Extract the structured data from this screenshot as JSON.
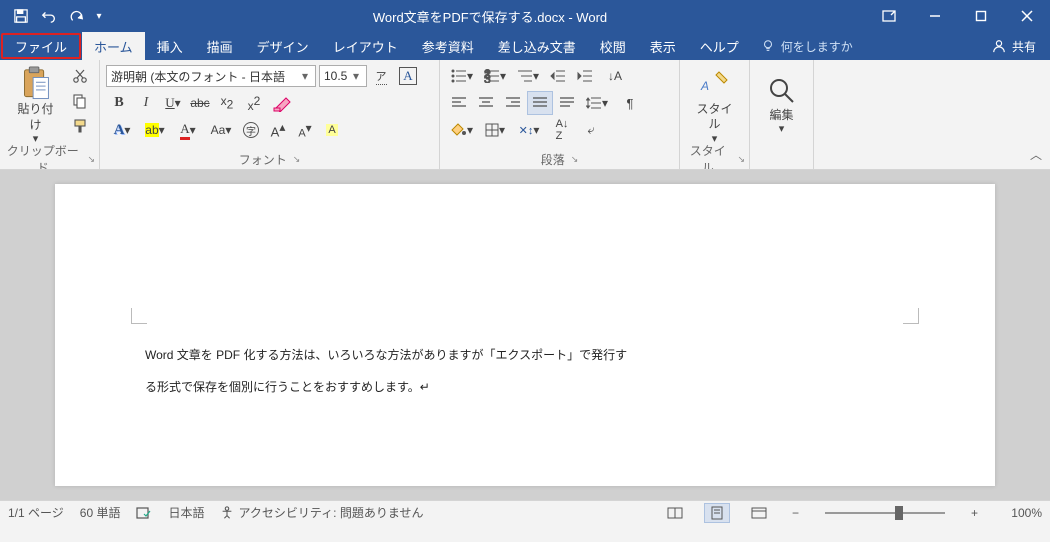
{
  "title": "Word文章をPDFで保存する.docx  -  Word",
  "tabs": {
    "file": "ファイル",
    "home": "ホーム",
    "insert": "挿入",
    "draw": "描画",
    "design": "デザイン",
    "layout": "レイアウト",
    "references": "参考資料",
    "mailings": "差し込み文書",
    "review": "校閲",
    "view": "表示",
    "help": "ヘルプ",
    "tellme": "何をしますか",
    "share": "共有"
  },
  "ribbon": {
    "clipboard": {
      "paste": "貼り付け",
      "label": "クリップボード"
    },
    "font": {
      "name": "游明朝 (本文のフォント - 日本語",
      "size": "10.5",
      "label": "フォント"
    },
    "paragraph": {
      "label": "段落"
    },
    "styles": {
      "label": "スタイル",
      "btn": "スタイル"
    },
    "editing": {
      "label": " ",
      "btn": "編集"
    }
  },
  "document": {
    "line1": "Word 文章を PDF 化する方法は、いろいろな方法がありますが「エクスポート」で発行す",
    "line2": "る形式で保存を個別に行うことをおすすめします。↵"
  },
  "status": {
    "page": "1/1 ページ",
    "words": "60 単語",
    "lang": "日本語",
    "a11y": "アクセシビリティ: 問題ありません",
    "zoom": "100%"
  }
}
